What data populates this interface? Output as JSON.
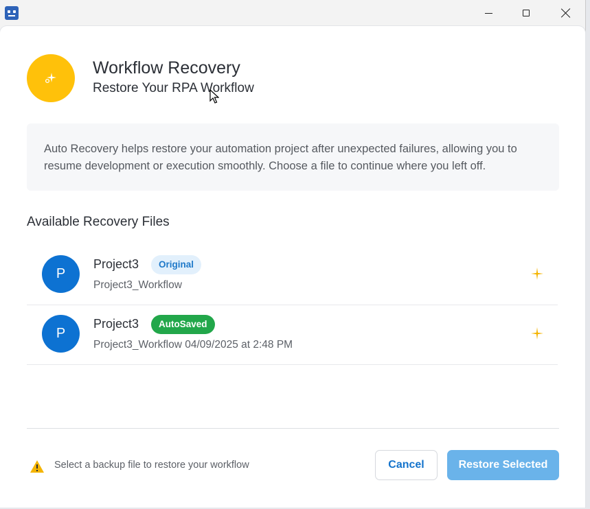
{
  "window": {
    "app_icon": "robot-icon",
    "controls": [
      "minimize-icon",
      "maximize-icon",
      "close-icon"
    ]
  },
  "header": {
    "icon": "sparkle-icon",
    "title": "Workflow Recovery",
    "subtitle": "Restore Your RPA Workflow"
  },
  "info": {
    "text": "Auto Recovery helps restore your automation project after unexpected failures, allowing you to resume development or execution smoothly. Choose a file to continue where you left off."
  },
  "files": {
    "section_title": "Available Recovery Files",
    "items": [
      {
        "avatar": "P",
        "name": "Project3",
        "badge": "Original",
        "subtitle": "Project3_Workflow",
        "icon": "sparkle-icon"
      },
      {
        "avatar": "P",
        "name": "Project3",
        "badge": "AutoSaved",
        "subtitle": "Project3_Workflow 04/09/2025 at 2:48 PM",
        "icon": "sparkle-icon"
      }
    ]
  },
  "footer": {
    "warning_icon": "warning-icon",
    "message": "Select a backup file to restore your workflow",
    "cancel_label": "Cancel",
    "restore_label": "Restore Selected"
  },
  "colors": {
    "accent": "#0d72d2",
    "header_icon_bg": "#ffc10a",
    "badge_original_bg": "#e2f0fc",
    "badge_autosaved_bg": "#22a74a",
    "restore_button_bg": "#6ab3ea"
  }
}
